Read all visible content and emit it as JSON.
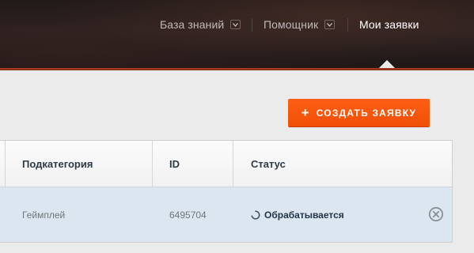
{
  "nav": {
    "items": [
      {
        "label": "База знаний",
        "dropdown": true
      },
      {
        "label": "Помощник",
        "dropdown": true
      },
      {
        "label": "Мои заявки",
        "dropdown": false,
        "active": true
      }
    ]
  },
  "actions": {
    "create_plus": "+",
    "create_label": "СОЗДАТЬ ЗАЯВКУ"
  },
  "table": {
    "columns": [
      "Подкатегория",
      "ID",
      "Статус"
    ],
    "rows": [
      {
        "subcategory": "Геймплей",
        "id": "6495704",
        "status": "Обрабатывается",
        "status_icon": "loading-spinner-icon",
        "action_icon": "close-circle-icon"
      }
    ]
  },
  "colors": {
    "accent": "#f25306",
    "header_bg": "#241b1a",
    "row_highlight": "#dbe6f0",
    "status_text": "#233448"
  }
}
